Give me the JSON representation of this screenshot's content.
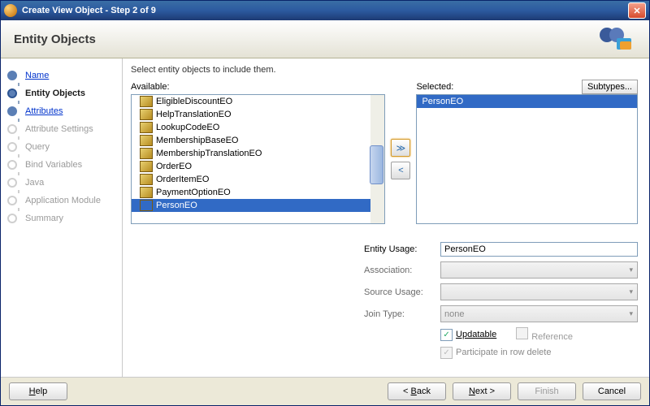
{
  "window": {
    "title": "Create View Object - Step 2 of 9"
  },
  "header": {
    "title": "Entity Objects"
  },
  "steps": [
    {
      "label": "Name",
      "state": "done",
      "link": true
    },
    {
      "label": "Entity Objects",
      "state": "active",
      "link": false
    },
    {
      "label": "Attributes",
      "state": "done",
      "link": true
    },
    {
      "label": "Attribute Settings",
      "state": "pending",
      "link": false
    },
    {
      "label": "Query",
      "state": "pending",
      "link": false
    },
    {
      "label": "Bind Variables",
      "state": "pending",
      "link": false
    },
    {
      "label": "Java",
      "state": "pending",
      "link": false
    },
    {
      "label": "Application Module",
      "state": "pending",
      "link": false
    },
    {
      "label": "Summary",
      "state": "pending",
      "link": false
    }
  ],
  "main": {
    "instruction": "Select entity objects to include them.",
    "available_label": "Available:",
    "selected_label": "Selected:",
    "subtypes_label": "Subtypes...",
    "available": [
      "EligibleDiscountEO",
      "HelpTranslationEO",
      "LookupCodeEO",
      "MembershipBaseEO",
      "MembershipTranslationEO",
      "OrderEO",
      "OrderItemEO",
      "PaymentOptionEO",
      "PersonEO"
    ],
    "available_selected_index": 8,
    "selected": [
      "PersonEO"
    ],
    "selected_selected_index": 0
  },
  "form": {
    "entity_usage_label": "Entity Usage:",
    "entity_usage_value": "PersonEO",
    "association_label": "Association:",
    "source_usage_label": "Source Usage:",
    "join_type_label": "Join Type:",
    "join_type_value": "none",
    "updatable_label": "Updatable",
    "reference_label": "Reference",
    "participate_label": "Participate in row delete",
    "updatable_checked": true,
    "reference_checked": false,
    "participate_checked": true
  },
  "footer": {
    "help": "Help",
    "back": "< Back",
    "next": "Next >",
    "finish": "Finish",
    "cancel": "Cancel"
  }
}
